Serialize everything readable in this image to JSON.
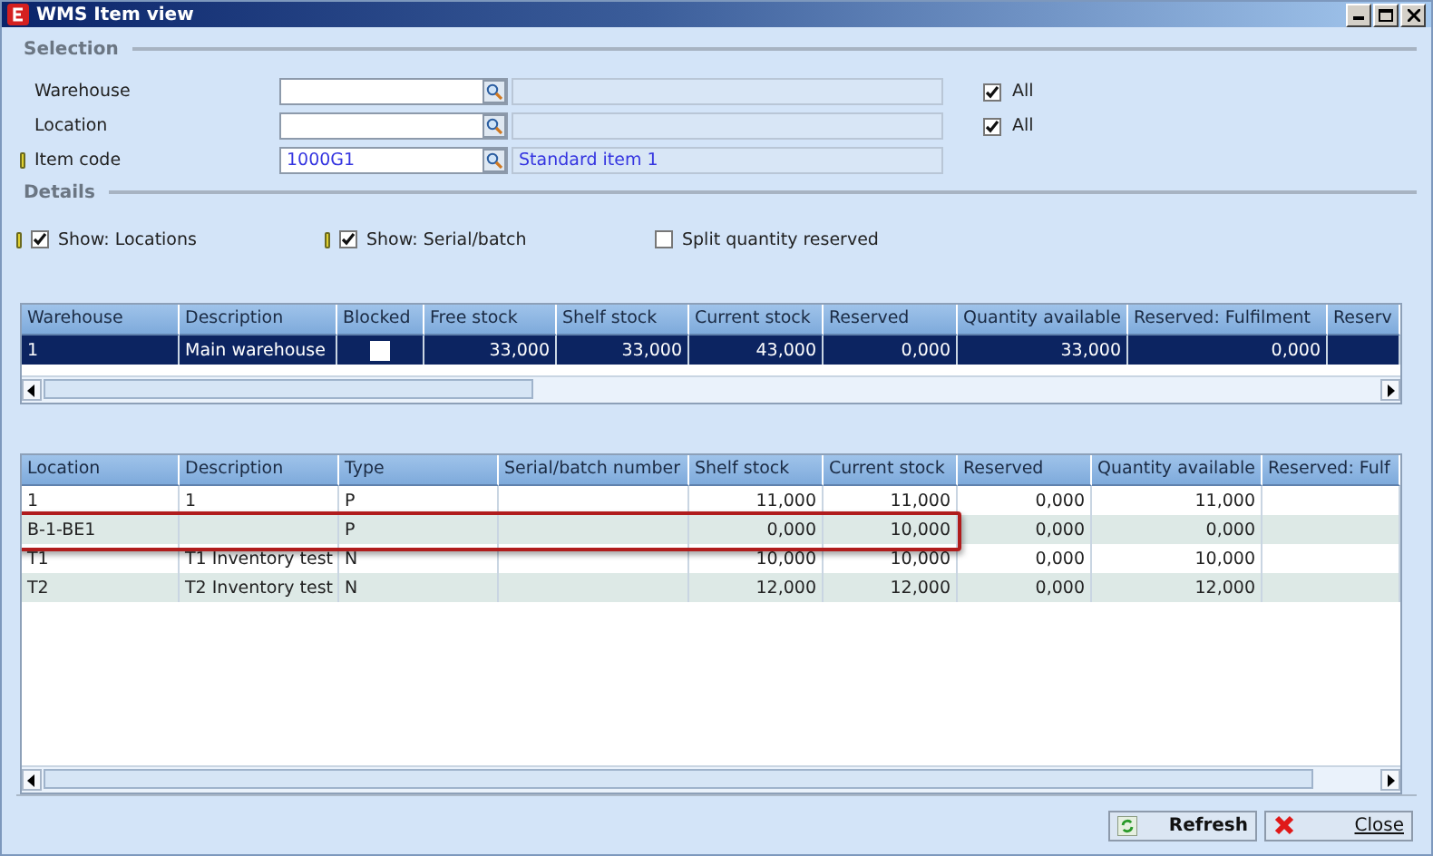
{
  "window": {
    "title": "WMS Item view"
  },
  "selection": {
    "title": "Selection",
    "fields": [
      {
        "label": "Warehouse",
        "required": false,
        "all": {
          "label": "All",
          "checked": true
        }
      },
      {
        "label": "Location",
        "required": false,
        "all": {
          "label": "All",
          "checked": true
        }
      },
      {
        "label": "Item code",
        "value": "1000G1",
        "description": "Standard item 1",
        "required": true
      }
    ]
  },
  "details": {
    "title": "Details",
    "options": [
      {
        "label": "Show: Locations",
        "checked": true,
        "required": true
      },
      {
        "label": "Show: Serial/batch",
        "checked": true,
        "required": true
      },
      {
        "label": "Split quantity reserved",
        "checked": false,
        "required": false
      }
    ]
  },
  "warehouse_table": {
    "columns": [
      {
        "label": "Warehouse",
        "kind": "text"
      },
      {
        "label": "Description",
        "kind": "text"
      },
      {
        "label": "Blocked",
        "kind": "check"
      },
      {
        "label": "Free stock",
        "kind": "number"
      },
      {
        "label": "Shelf stock",
        "kind": "number"
      },
      {
        "label": "Current stock",
        "kind": "number"
      },
      {
        "label": "Reserved",
        "kind": "number"
      },
      {
        "label": "Quantity available",
        "kind": "number"
      },
      {
        "label": "Reserved: Fulfilment",
        "kind": "number"
      },
      {
        "label": "Reserv",
        "kind": "text"
      }
    ],
    "rows": [
      {
        "selected": true,
        "highlighted": false,
        "cells": [
          "1",
          "Main warehouse",
          false,
          "33,000",
          "33,000",
          "43,000",
          "0,000",
          "33,000",
          "0,000",
          null
        ]
      }
    ]
  },
  "location_table": {
    "columns": [
      {
        "label": "Location",
        "kind": "text"
      },
      {
        "label": "Description",
        "kind": "text"
      },
      {
        "label": "Type",
        "kind": "text"
      },
      {
        "label": "Serial/batch number",
        "kind": "text"
      },
      {
        "label": "Shelf stock",
        "kind": "number"
      },
      {
        "label": "Current stock",
        "kind": "number"
      },
      {
        "label": "Reserved",
        "kind": "number"
      },
      {
        "label": "Quantity available",
        "kind": "number"
      },
      {
        "label": "Reserved: Fulf",
        "kind": "text"
      }
    ],
    "rows": [
      {
        "selected": false,
        "highlighted": false,
        "cells": [
          "1",
          "1",
          "P",
          null,
          "11,000",
          "11,000",
          "0,000",
          "11,000",
          null
        ]
      },
      {
        "selected": false,
        "highlighted": true,
        "cells": [
          "B-1-BE1",
          null,
          "P",
          null,
          "0,000",
          "10,000",
          "0,000",
          "0,000",
          null
        ]
      },
      {
        "selected": false,
        "highlighted": false,
        "cells": [
          "T1",
          "T1 Inventory test",
          "N",
          null,
          "10,000",
          "10,000",
          "0,000",
          "10,000",
          null
        ]
      },
      {
        "selected": false,
        "highlighted": false,
        "cells": [
          "T2",
          "T2 Inventory test",
          "N",
          null,
          "12,000",
          "12,000",
          "0,000",
          "12,000",
          null
        ]
      }
    ]
  },
  "buttons": [
    {
      "label": "Refresh",
      "kind": "refresh"
    },
    {
      "label": "Close",
      "kind": "close"
    }
  ]
}
